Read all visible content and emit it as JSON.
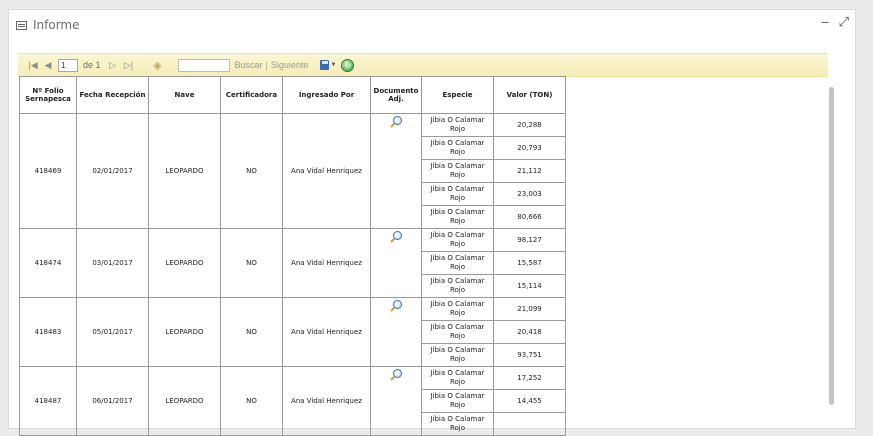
{
  "panel": {
    "title": "Informe",
    "minimize_icon": "minimize-icon",
    "expand_icon": "expand-icon"
  },
  "toolbar": {
    "page_value": "1",
    "of_label": "de 1",
    "search_value": "",
    "buscar_label": "Buscar",
    "separator": "|",
    "siguiente_label": "Siguiente"
  },
  "table": {
    "headers": [
      "Nº Folio Sernapesca",
      "Fecha Recepción",
      "Nave",
      "Certificadora",
      "Ingresado Por",
      "Documento Adj.",
      "Especie",
      "Valor (TON)"
    ],
    "groups": [
      {
        "folio": "418469",
        "fecha": "02/01/2017",
        "nave": "LEOPARDO",
        "cert": "NO",
        "ingresado": "Ana Vidal Henriquez",
        "items": [
          {
            "especie": "Jibia O Calamar Rojo",
            "valor": "20,288"
          },
          {
            "especie": "Jibia O Calamar Rojo",
            "valor": "20,793"
          },
          {
            "especie": "Jibia O Calamar Rojo",
            "valor": "21,112"
          },
          {
            "especie": "Jibia O Calamar Rojo",
            "valor": "23,003"
          },
          {
            "especie": "Jibia O Calamar Rojo",
            "valor": "80,666"
          }
        ]
      },
      {
        "folio": "418474",
        "fecha": "03/01/2017",
        "nave": "LEOPARDO",
        "cert": "NO",
        "ingresado": "Ana Vidal Henriquez",
        "items": [
          {
            "especie": "Jibia O Calamar Rojo",
            "valor": "98,127"
          },
          {
            "especie": "Jibia O Calamar Rojo",
            "valor": "15,587"
          },
          {
            "especie": "Jibia O Calamar Rojo",
            "valor": "15,114"
          }
        ]
      },
      {
        "folio": "418483",
        "fecha": "05/01/2017",
        "nave": "LEOPARDO",
        "cert": "NO",
        "ingresado": "Ana Vidal Henriquez",
        "items": [
          {
            "especie": "Jibia O Calamar Rojo",
            "valor": "21,099"
          },
          {
            "especie": "Jibia O Calamar Rojo",
            "valor": "20,418"
          },
          {
            "especie": "Jibia O Calamar Rojo",
            "valor": "93,751"
          }
        ]
      },
      {
        "folio": "418487",
        "fecha": "06/01/2017",
        "nave": "LEOPARDO",
        "cert": "NO",
        "ingresado": "Ana Vidal Henriquez",
        "items": [
          {
            "especie": "Jibia O Calamar Rojo",
            "valor": "17,252"
          },
          {
            "especie": "Jibia O Calamar Rojo",
            "valor": "14,455"
          },
          {
            "especie": "Jibia O Calamar Rojo",
            "valor": ""
          }
        ]
      }
    ]
  },
  "colors": {
    "toolbar_bg": "#f5edb5",
    "border": "#9a9a9a",
    "title_text": "#6f6f6f"
  }
}
